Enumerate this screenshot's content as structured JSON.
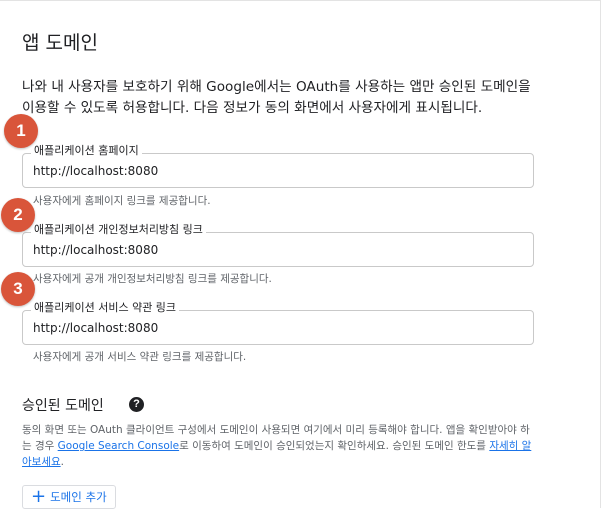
{
  "section": {
    "title": "앱 도메인"
  },
  "intro": "나와 내 사용자를 보호하기 위해 Google에서는 OAuth를 사용하는 앱만 승인된 도메인을 이용할 수 있도록 허용합니다. 다음 정보가 동의 화면에서 사용자에게 표시됩니다.",
  "fields": [
    {
      "badge": "1",
      "label": "애플리케이션 홈페이지",
      "value": "http://localhost:8080",
      "hint": "사용자에게 홈페이지 링크를 제공합니다."
    },
    {
      "badge": "2",
      "label": "애플리케이션 개인정보처리방침 링크",
      "value": "http://localhost:8080",
      "hint": "사용자에게 공개 개인정보처리방침 링크를 제공합니다."
    },
    {
      "badge": "3",
      "label": "애플리케이션 서비스 약관 링크",
      "value": "http://localhost:8080",
      "hint": "사용자에게 공개 서비스 약관 링크를 제공합니다."
    }
  ],
  "authorized": {
    "title": "승인된 도메인",
    "help_icon": "?",
    "desc_part1": "동의 화면 또는 OAuth 클라이언트 구성에서 도메인이 사용되면 여기에서 미리 등록해야 합니다. 앱을 확인받아야 하는 경우 ",
    "link1": "Google Search Console",
    "desc_part2": "로 이동하여 도메인이 승인되었는지 확인하세요. 승인된 도메인 한도를 ",
    "link2": "자세히 알아보세요",
    "desc_part3": ".",
    "add_button": "도메인 추가"
  },
  "colors": {
    "badge": "#d9553a",
    "link": "#1a73e8"
  }
}
